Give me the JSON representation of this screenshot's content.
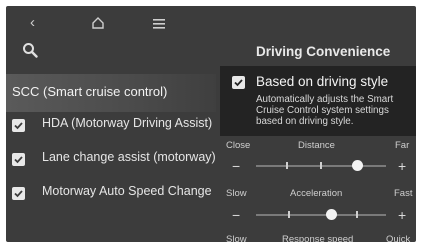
{
  "nav": {
    "back_icon": "chevron-left-icon",
    "home_icon": "home-icon",
    "menu_icon": "hamburger-menu-icon",
    "search_icon": "search-icon"
  },
  "menu": {
    "selected_label": "SCC (Smart cruise control)",
    "items": [
      {
        "label": "HDA (Motorway Driving Assist)",
        "checked": true
      },
      {
        "label": "Lane change assist (motorway)",
        "checked": true
      },
      {
        "label": "Motorway Auto Speed Change",
        "checked": true
      }
    ]
  },
  "panel": {
    "title": "Driving Convenience",
    "popup": {
      "checked": true,
      "title": "Based on driving style",
      "description": "Automatically adjusts the Smart Cruise Control system settings based on driving style."
    },
    "sliders": [
      {
        "left": "Close",
        "center": "Distance",
        "right": "Far",
        "minus": "−",
        "plus": "+",
        "level": 0.78
      },
      {
        "left": "Slow",
        "center": "Acceleration",
        "right": "Fast",
        "minus": "−",
        "plus": "+",
        "level": 0.58
      },
      {
        "left": "Slow",
        "center": "Response speed",
        "right": "Quick"
      }
    ]
  },
  "colors": {
    "screen_bg": "#3c3c3c",
    "popup_bg": "#232323",
    "text": "#e6e6e6"
  }
}
